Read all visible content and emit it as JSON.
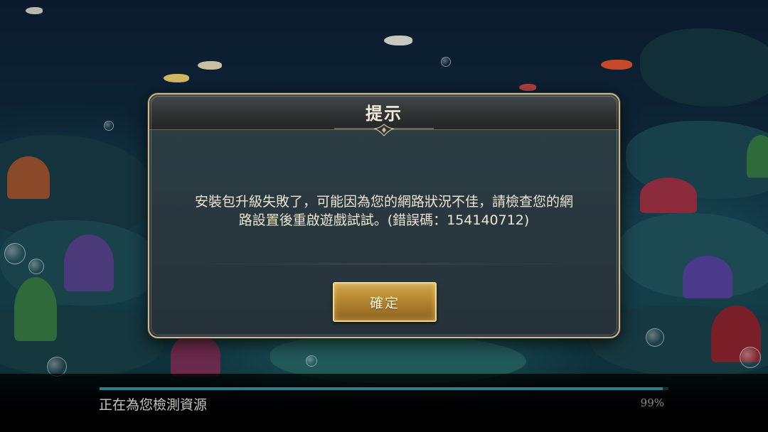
{
  "dialog": {
    "title": "提示",
    "message_line1": "安裝包升級失敗了，可能因為您的網路狀況不佳，請檢查您的網",
    "message_line2": "路設置後重啟遊戲試試。(錯誤碼：154140712)",
    "confirm_label": "確定"
  },
  "loading": {
    "status": "正在為您檢測資源",
    "percent_text": "99%",
    "progress": 0.99
  },
  "colors": {
    "accent_gold": "#c9b98e",
    "progress_fill": "#2e7f8e",
    "button_gold": "#b5862f"
  },
  "icons": {
    "dialog_ornament": "diamond-ornament-icon"
  }
}
